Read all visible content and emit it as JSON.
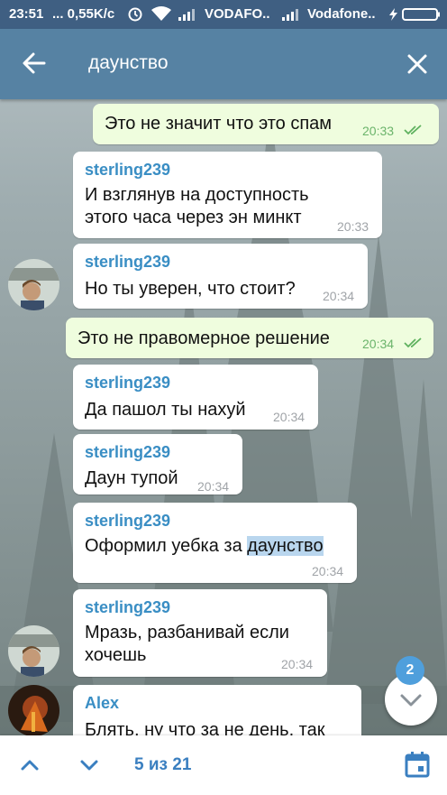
{
  "status_bar": {
    "time": "23:51",
    "speed": "... 0,55K/c",
    "carrier1": "VODAFO..",
    "carrier2": "Vodafone..",
    "icons": [
      "alarm-icon",
      "wifi-icon",
      "signal-icon",
      "signal-icon",
      "battery-charging-icon"
    ]
  },
  "header": {
    "search_query": "даунство",
    "back_icon": "arrow-left-icon",
    "close_icon": "close-icon"
  },
  "messages": [
    {
      "direction": "out",
      "text": "Это не значит что это спам",
      "time": "20:33",
      "status": "read"
    },
    {
      "direction": "in",
      "sender": "sterling239",
      "text": "И взглянув на доступность\nэтого часа через эн минкт",
      "time": "20:33"
    },
    {
      "direction": "in",
      "sender": "sterling239",
      "text": "Но ты уверен, что стоит?",
      "time": "20:34"
    },
    {
      "direction": "out",
      "text": "Это не правомерное решение",
      "time": "20:34",
      "status": "read"
    },
    {
      "direction": "in",
      "sender": "sterling239",
      "text": "Да пашол ты нахуй",
      "time": "20:34"
    },
    {
      "direction": "in",
      "sender": "sterling239",
      "text": "Даун тупой",
      "time": "20:34"
    },
    {
      "direction": "in",
      "sender": "sterling239",
      "text_before": "Оформил уебка за ",
      "text_highlight": "даунство",
      "time": "20:34"
    },
    {
      "direction": "in",
      "sender": "sterling239",
      "text": "Мразь, разбанивай если\nхочешь",
      "time": "20:34"
    },
    {
      "direction": "in",
      "sender": "Alex",
      "text": "Блять, ну что за не день, так"
    }
  ],
  "scroll_fab": {
    "unread_count": "2",
    "icon": "chevron-down-icon"
  },
  "bottom_bar": {
    "up_icon": "chevron-up-icon",
    "down_icon": "chevron-down-icon",
    "counter": "5 из 21",
    "calendar_icon": "calendar-icon"
  },
  "colors": {
    "header": "#5682a3",
    "status_bar": "#3f5f82",
    "sender": "#3a8ec4",
    "outgoing": "#effdde",
    "accent": "#3a7fc0",
    "badge": "#4f9fdc"
  }
}
